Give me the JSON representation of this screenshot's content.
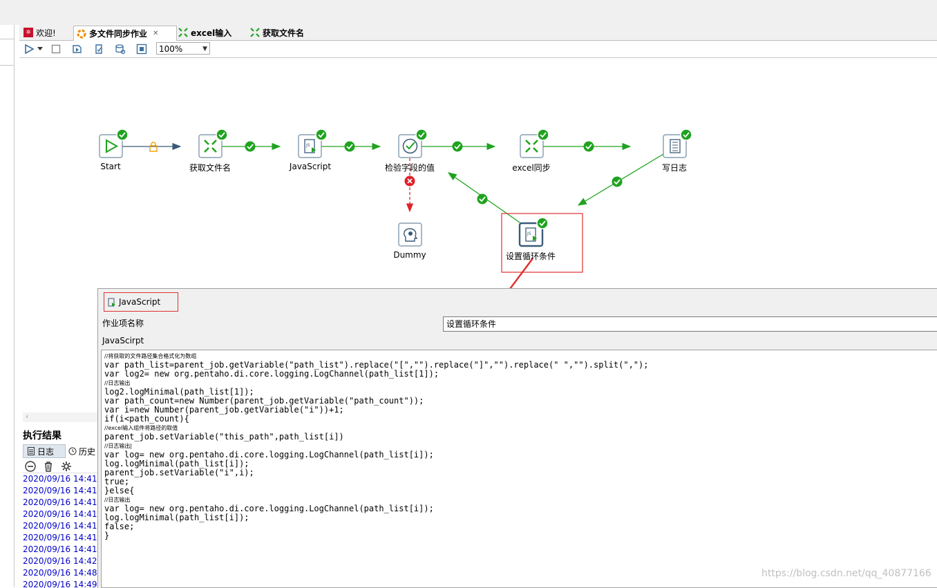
{
  "tabs": [
    {
      "label": "欢迎!",
      "icon": "welcome-icon"
    },
    {
      "label": "多文件同步作业",
      "icon": "job-icon",
      "active": true,
      "close": "✕"
    },
    {
      "label": "excel输入",
      "icon": "transformation-icon"
    },
    {
      "label": "获取文件名",
      "icon": "transformation-icon"
    }
  ],
  "toolbar": {
    "zoom": "100%",
    "icons": [
      "run-icon",
      "run-dropdown-icon",
      "stop-icon",
      "replay-icon",
      "check-icon",
      "sql-icon",
      "explore-db-icon"
    ]
  },
  "canvas": {
    "nodes": [
      {
        "id": "start",
        "label": "Start",
        "icon": "start-icon"
      },
      {
        "id": "getfiles",
        "label": "获取文件名",
        "icon": "transformation-icon"
      },
      {
        "id": "js",
        "label": "JavaScript",
        "icon": "javascript-icon"
      },
      {
        "id": "check",
        "label": "检验字段的值",
        "icon": "check-field-icon"
      },
      {
        "id": "excel",
        "label": "excel同步",
        "icon": "transformation-icon"
      },
      {
        "id": "log",
        "label": "写日志",
        "icon": "write-log-icon"
      },
      {
        "id": "dummy",
        "label": "Dummy",
        "icon": "dummy-icon"
      },
      {
        "id": "loop",
        "label": "设置循环条件",
        "icon": "javascript-icon"
      }
    ],
    "colors": {
      "success": "#1fa31f",
      "fail": "#e0202a",
      "lock": "#f0a000",
      "hop": "#3a5a78",
      "annotation": "#e03030"
    }
  },
  "results": {
    "title": "执行结果",
    "tabs": [
      "日志",
      "历史"
    ],
    "tool_icons": [
      "stop-log-icon",
      "trash-icon",
      "settings-icon"
    ],
    "log_lines": [
      "2020/09/16 14:41:",
      "2020/09/16 14:41:",
      "2020/09/16 14:41:",
      "2020/09/16 14:41:",
      "2020/09/16 14:41:",
      "2020/09/16 14:41:",
      "2020/09/16 14:41:",
      "2020/09/16 14:42:",
      "2020/09/16 14:48:",
      "2020/09/16 14:49:"
    ]
  },
  "dialog": {
    "title": "JavaScript",
    "name_label": "作业项名称",
    "name_value": "设置循环条件",
    "script_label": "JavaScirpt",
    "code_lines": [
      {
        "t": "//将获取的文件路径集合格式化为数组",
        "c": true
      },
      {
        "t": "var path_list=parent_job.getVariable(\"path_list\").replace(\"[\",\"\").replace(\"]\",\"\").replace(\" \",\"\").split(\",\");"
      },
      {
        "t": "var log2= new org.pentaho.di.core.logging.LogChannel(path_list[1]);"
      },
      {
        "t": "//日志输出",
        "c": true
      },
      {
        "t": "log2.logMinimal(path_list[1]);"
      },
      {
        "t": "var path_count=new Number(parent_job.getVariable(\"path_count\"));"
      },
      {
        "t": "var i=new Number(parent_job.getVariable(\"i\"))+1;"
      },
      {
        "t": "if(i<path_count){"
      },
      {
        "t": "//excel输入组件将路径的取值",
        "c": true
      },
      {
        "t": "parent_job.setVariable(\"this_path\",path_list[i])"
      },
      {
        "t": "//日志输出|",
        "c": true
      },
      {
        "t": "var log= new org.pentaho.di.core.logging.LogChannel(path_list[i]);"
      },
      {
        "t": "log.logMinimal(path_list[i]);"
      },
      {
        "t": "parent_job.setVariable(\"i\",i);"
      },
      {
        "t": "true;"
      },
      {
        "t": "}else{"
      },
      {
        "t": "//日志输出",
        "c": true
      },
      {
        "t": "var log= new org.pentaho.di.core.logging.LogChannel(path_list[i]);"
      },
      {
        "t": "log.logMinimal(path_list[i]);"
      },
      {
        "t": "false;"
      },
      {
        "t": "}"
      }
    ]
  },
  "watermark": "https://blog.csdn.net/qq_40877166"
}
